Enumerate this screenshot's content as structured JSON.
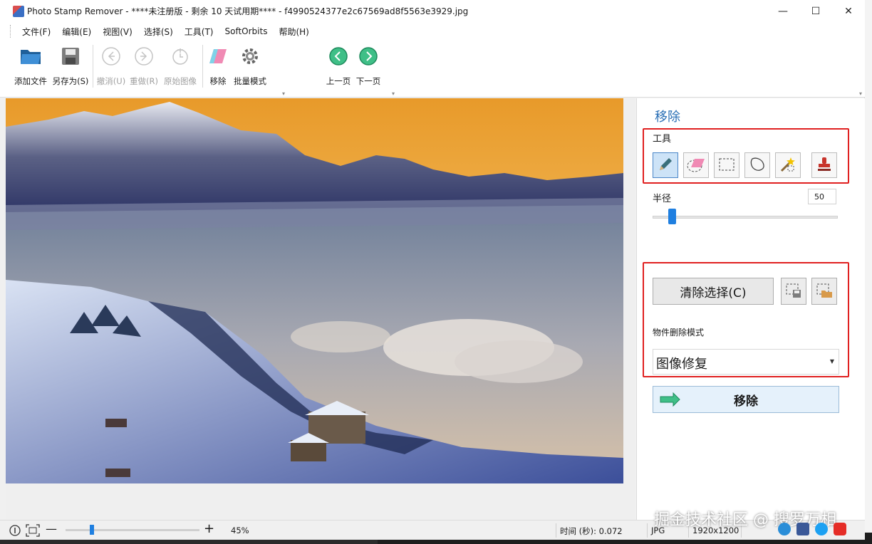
{
  "window": {
    "title": "Photo Stamp Remover - ****未注册版 - 剩余 10 天试用期**** - f4990524377e2c67569ad8f5563e3929.jpg",
    "controls": {
      "minimize": "—",
      "maximize": "☐",
      "close": "✕"
    }
  },
  "menu": [
    "文件(F)",
    "编辑(E)",
    "视图(V)",
    "选择(S)",
    "工具(T)",
    "SoftOrbits",
    "帮助(H)"
  ],
  "toolbar": {
    "add_file": "添加文件",
    "save_as": "另存为(S)",
    "undo": "撤消(U)",
    "redo": "重做(R)",
    "original": "原始图像",
    "remove": "移除",
    "batch": "批量模式",
    "prev": "上一页",
    "next": "下一页"
  },
  "panel": {
    "title": "移除",
    "tools_label": "工具",
    "tools": [
      "pencil",
      "eraser",
      "rect-select",
      "lasso",
      "magic-wand",
      "stamp"
    ],
    "active_tool": "pencil",
    "radius_label": "半径",
    "radius_value": "50",
    "radius_fraction": 0.1,
    "clear_button": "清除选择(C)",
    "mode_label": "物件删除模式",
    "mode_value": "图像修复",
    "remove_button": "移除"
  },
  "status": {
    "zoom": "45%",
    "zoom_fraction": 0.2,
    "time": "时间 (秒): 0.072",
    "format": "JPG",
    "size": "1920x1200"
  },
  "watermark": "掘金技术社区 @ 搜罗万相",
  "colors": {
    "accent": "#2a6fb5",
    "highlight": "#e02020",
    "slider": "#1f7fe0"
  }
}
